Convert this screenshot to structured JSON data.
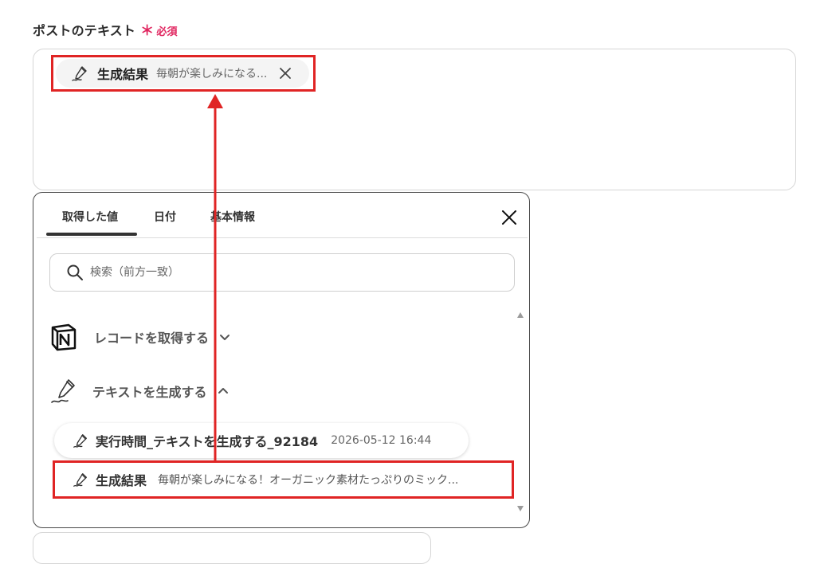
{
  "field": {
    "label": "ポストのテキスト",
    "required_mark": "＊",
    "required_text": "必須"
  },
  "chip": {
    "label": "生成結果",
    "value": "毎朝が楽しみになる...",
    "icon": "pen-icon",
    "close_icon": "close-icon"
  },
  "popup": {
    "tabs": [
      {
        "label": "取得した値",
        "active": true
      },
      {
        "label": "日付",
        "active": false
      },
      {
        "label": "基本情報",
        "active": false
      }
    ],
    "search_placeholder": "検索（前方一致）",
    "sections": [
      {
        "label": "レコードを取得する",
        "icon": "notion-icon",
        "expanded": false
      },
      {
        "label": "テキストを生成する",
        "icon": "pen-icon",
        "expanded": true
      }
    ],
    "step_item": {
      "label": "実行時間_テキストを生成する_92184",
      "timestamp": "2026-05-12 16:44"
    },
    "result_item": {
      "label": "生成結果",
      "value": "毎朝が楽しみになる！オーガニック素材たっぷりのミック..."
    }
  },
  "colors": {
    "highlight": "#e02424",
    "required": "#e0245e"
  }
}
